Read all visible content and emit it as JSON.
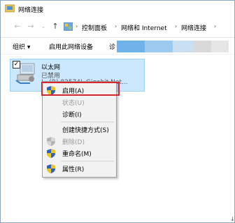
{
  "window": {
    "title": "网络连接"
  },
  "address": {
    "back_icon": "back-arrow-icon",
    "forward_icon": "forward-arrow-icon",
    "up_icon": "up-arrow-icon",
    "crumbs": [
      "控制面板",
      "网络和 Internet",
      "网络连接"
    ]
  },
  "toolbar": {
    "organize": "组织 ▾",
    "enable_device": "启用此网络设备",
    "partial": "诊"
  },
  "adapter": {
    "name": "以太网",
    "status": "已禁用",
    "description": "I...(R) 82574L Gigabit Net..."
  },
  "context_menu": {
    "items": [
      {
        "label": "启用(A)",
        "disabled": false,
        "shield": true
      },
      {
        "label": "状态(U)",
        "disabled": true,
        "shield": false
      },
      {
        "label": "诊断(I)",
        "disabled": false,
        "shield": false
      },
      {
        "label": "创建快捷方式(S)",
        "disabled": false,
        "shield": false
      },
      {
        "label": "删除(D)",
        "disabled": true,
        "shield": true
      },
      {
        "label": "重命名(M)",
        "disabled": false,
        "shield": true
      },
      {
        "label": "属性(R)",
        "disabled": false,
        "shield": true
      }
    ]
  },
  "colors": {
    "selection_bg": "#cce8ff",
    "highlight_border": "#d9262e",
    "menu_bg": "#f2f2f2"
  }
}
